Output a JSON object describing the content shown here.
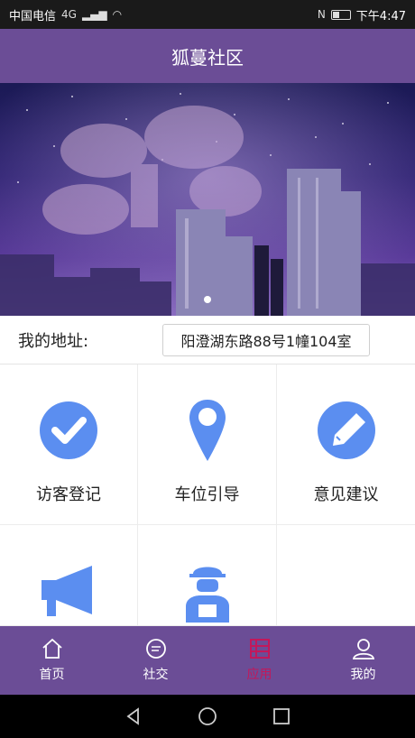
{
  "status_bar": {
    "carrier": "中国电信",
    "network": "4G",
    "time": "下午4:47"
  },
  "header": {
    "title": "狐蔓社区"
  },
  "banner": {
    "active_slide": 1,
    "slide_count": 1
  },
  "address": {
    "label": "我的地址:",
    "value": "阳澄湖东路88号1幢104室"
  },
  "services": [
    {
      "label": "访客登记",
      "icon": "check-circle-icon"
    },
    {
      "label": "车位引导",
      "icon": "location-pin-icon"
    },
    {
      "label": "意见建议",
      "icon": "pencil-circle-icon"
    },
    {
      "label": "",
      "icon": "megaphone-icon"
    },
    {
      "label": "",
      "icon": "worker-icon"
    },
    {
      "label": "",
      "icon": ""
    }
  ],
  "tabbar": {
    "items": [
      {
        "label": "首页",
        "icon": "home-icon"
      },
      {
        "label": "社交",
        "icon": "chat-icon"
      },
      {
        "label": "应用",
        "icon": "apps-icon",
        "active": true
      },
      {
        "label": "我的",
        "icon": "user-icon"
      }
    ]
  },
  "colors": {
    "primary": "#6b4d96",
    "icon_blue": "#5b8ef0",
    "active_tab": "#c2185b"
  }
}
